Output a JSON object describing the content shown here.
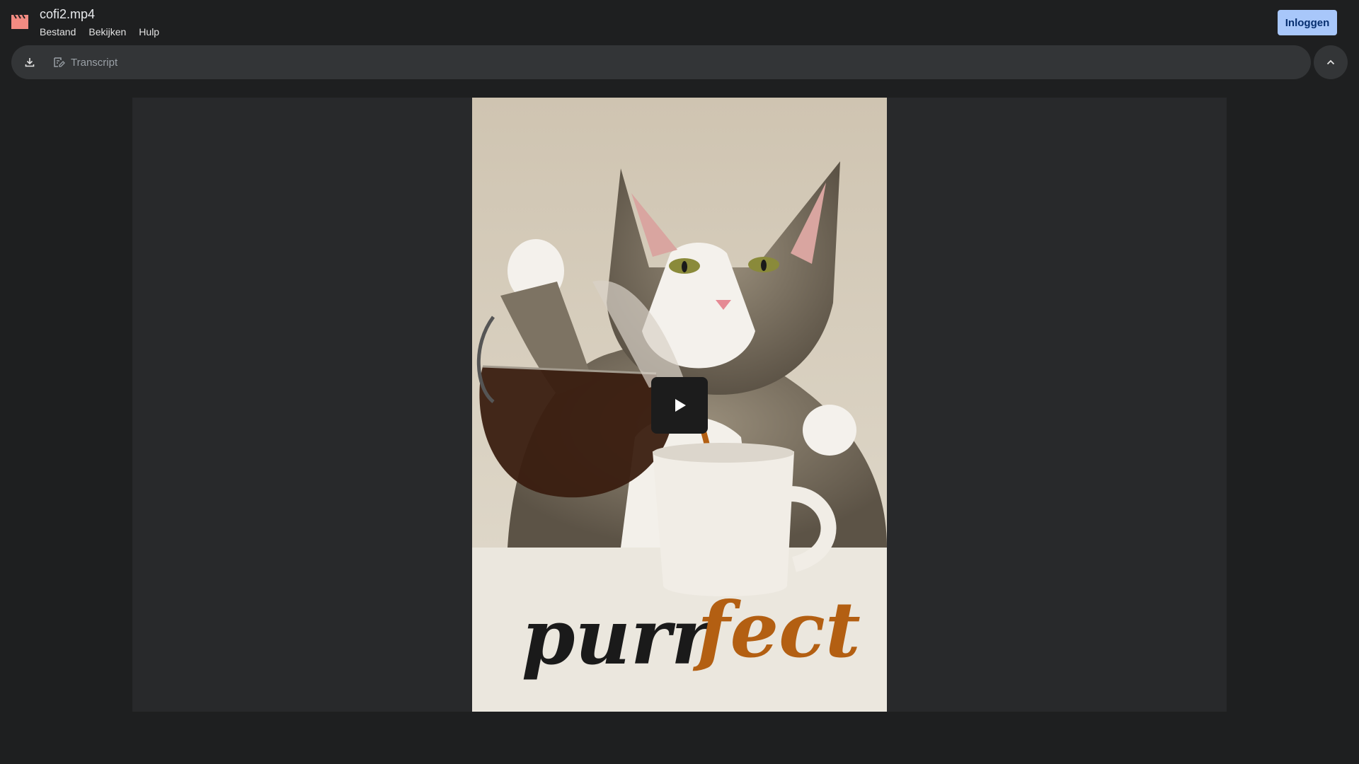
{
  "header": {
    "file_title": "cofi2.mp4",
    "menu": [
      {
        "label": "Bestand"
      },
      {
        "label": "Bekijken"
      },
      {
        "label": "Hulp"
      }
    ],
    "login_label": "Inloggen",
    "app_icon": "clapperboard-icon"
  },
  "toolbar": {
    "download_icon": "download-icon",
    "transcript_icon": "edit-note-icon",
    "transcript_label": "Transcript",
    "collapse_icon": "chevron-up-icon"
  },
  "video": {
    "caption_part1": "purr",
    "caption_part2": "fect",
    "play_icon": "play-icon"
  },
  "colors": {
    "background": "#1e1f20",
    "toolbar": "#333537",
    "accent": "#a8c7fa",
    "app_icon": "#f28b82",
    "caption_dark": "#1a1a1a",
    "caption_orange": "#b35f12"
  }
}
